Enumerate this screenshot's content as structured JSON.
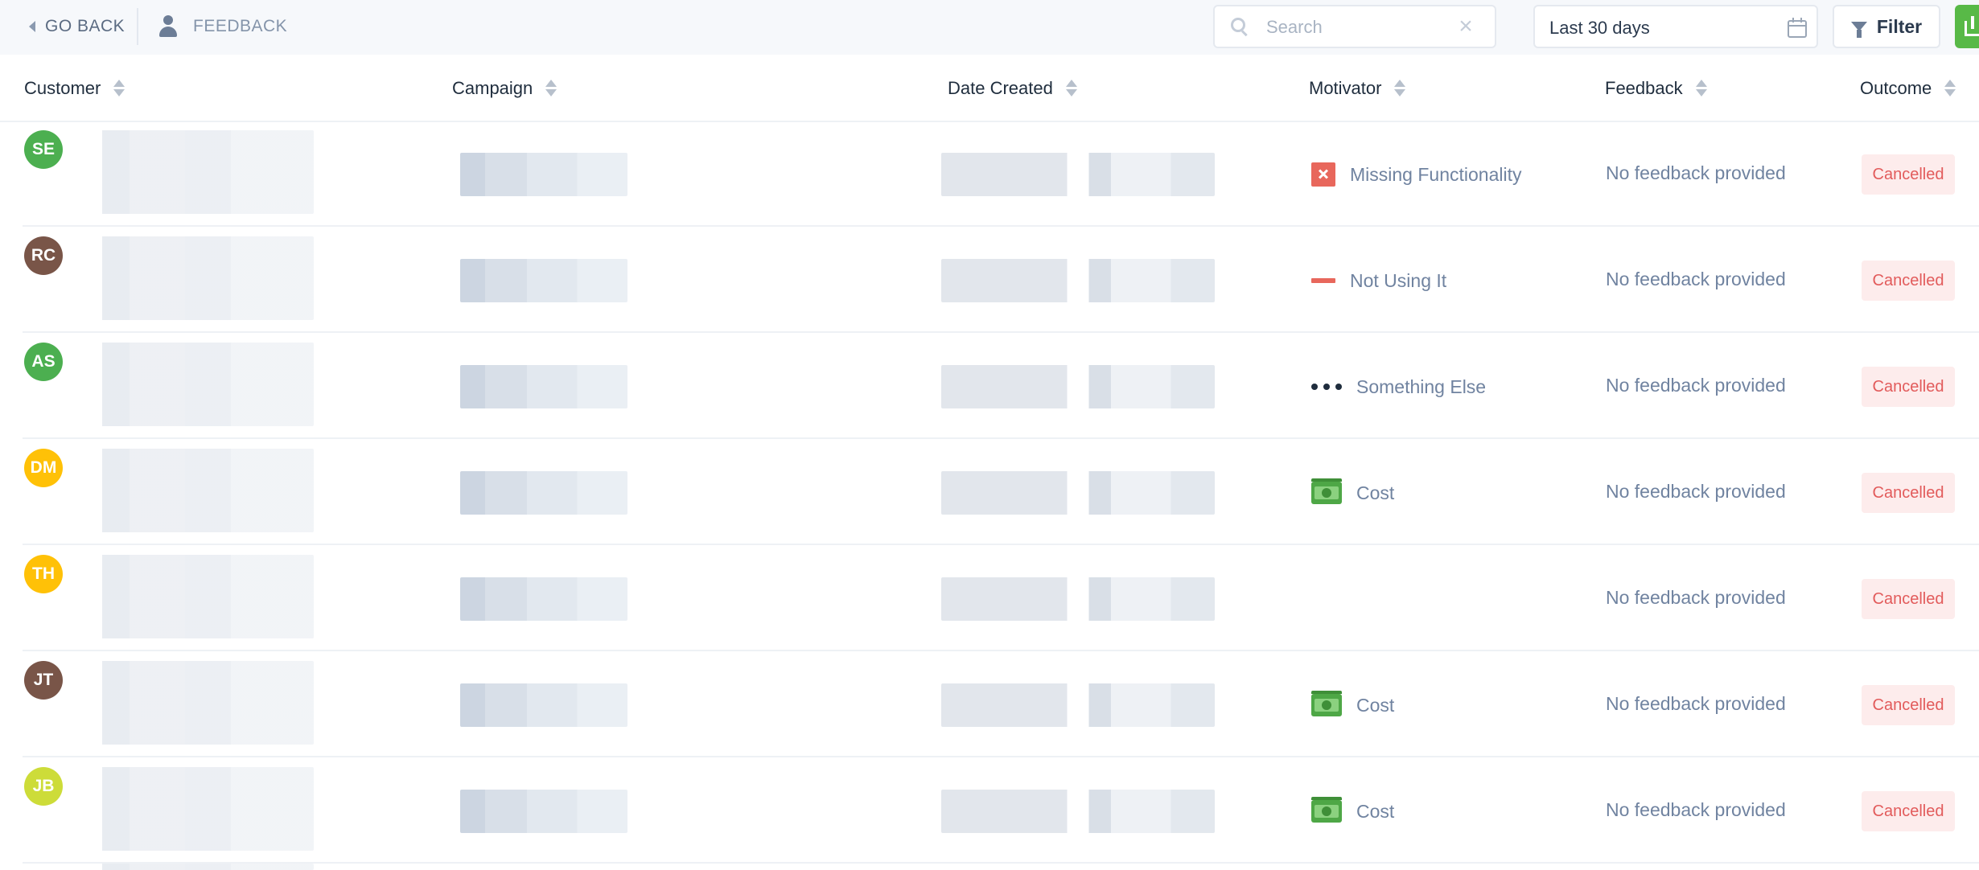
{
  "toolbar": {
    "go_back_label": "GO BACK",
    "breadcrumb_label": "FEEDBACK",
    "search_placeholder": "Search",
    "search_value": "",
    "clear_symbol": "×",
    "date_range": "Last 30 days",
    "filter_label": "Filter"
  },
  "table": {
    "columns": [
      "Customer",
      "Campaign",
      "Date Created",
      "Motivator",
      "Feedback",
      "Outcome"
    ],
    "rows": [
      {
        "initials": "SE",
        "avatar_color": "#4caf50",
        "motivator": "Missing Functionality",
        "motivator_icon": "x-square-icon",
        "feedback": "No feedback provided",
        "outcome": "Cancelled"
      },
      {
        "initials": "RC",
        "avatar_color": "#795548",
        "motivator": "Not Using It",
        "motivator_icon": "minus-icon",
        "feedback": "No feedback provided",
        "outcome": "Cancelled"
      },
      {
        "initials": "AS",
        "avatar_color": "#4caf50",
        "motivator": "Something Else",
        "motivator_icon": "ellipsis-icon",
        "feedback": "No feedback provided",
        "outcome": "Cancelled"
      },
      {
        "initials": "DM",
        "avatar_color": "#ffc107",
        "motivator": "Cost",
        "motivator_icon": "cash-icon",
        "feedback": "No feedback provided",
        "outcome": "Cancelled"
      },
      {
        "initials": "TH",
        "avatar_color": "#ffc107",
        "motivator": "",
        "motivator_icon": "",
        "feedback": "No feedback provided",
        "outcome": "Cancelled"
      },
      {
        "initials": "JT",
        "avatar_color": "#795548",
        "motivator": "Cost",
        "motivator_icon": "cash-icon",
        "feedback": "No feedback provided",
        "outcome": "Cancelled"
      },
      {
        "initials": "JB",
        "avatar_color": "#cddc39",
        "motivator": "Cost",
        "motivator_icon": "cash-icon",
        "feedback": "No feedback provided",
        "outcome": "Cancelled"
      }
    ]
  },
  "colors": {
    "accent_green": "#58b947",
    "outcome_text": "#e25b5b",
    "outcome_bg": "#fdecec"
  }
}
